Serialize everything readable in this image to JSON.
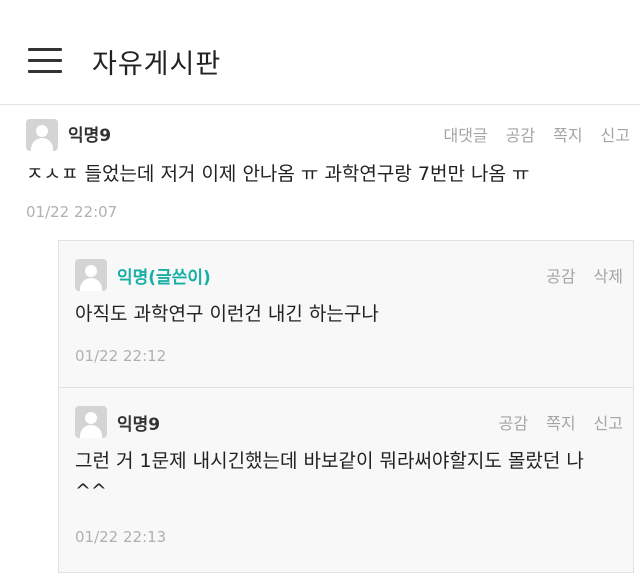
{
  "header": {
    "title": "자유게시판"
  },
  "comment": {
    "nick": "익명9",
    "actions": {
      "reply": "대댓글",
      "like": "공감",
      "message": "쪽지",
      "report": "신고"
    },
    "text": "ㅈㅅㅍ 들었는데 저거 이제 안나옴 ㅠ 과학연구랑 7번만 나옴 ㅠ",
    "time": "01/22 22:07"
  },
  "replies": [
    {
      "nick": "익명(글쓴이)",
      "actions": {
        "like": "공감",
        "delete": "삭제"
      },
      "text": "아직도 과학연구 이런건 내긴 하는구나",
      "time": "01/22 22:12"
    },
    {
      "nick": "익명9",
      "actions": {
        "like": "공감",
        "message": "쪽지",
        "report": "신고"
      },
      "text_line1": "그런 거 1문제 내시긴했는데 바보같이 뭐라써야할지도 몰랐던 나",
      "text_line2": "^^",
      "time": "01/22 22:13"
    }
  ]
}
